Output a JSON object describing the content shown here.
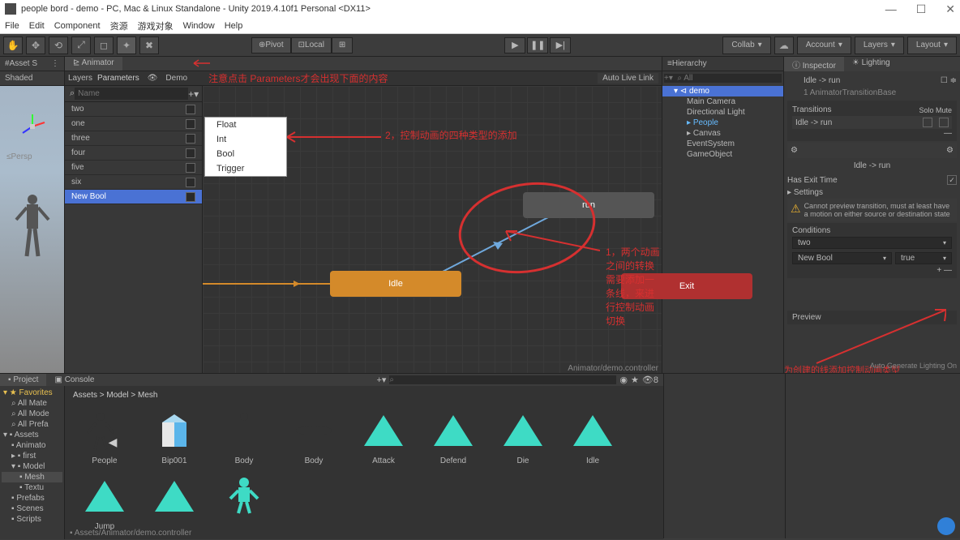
{
  "titlebar": {
    "text": "people bord - demo - PC, Mac & Linux Standalone - Unity 2019.4.10f1 Personal <DX11>"
  },
  "menu": [
    "File",
    "Edit",
    "Component",
    "资源",
    "游戏对象",
    "Window",
    "Help"
  ],
  "toolbar": {
    "pivot": "Pivot",
    "local": "Local",
    "collab": "Collab",
    "account": "Account",
    "layers": "Layers",
    "layout": "Layout"
  },
  "scene": {
    "tab": "Asset S",
    "shaded": "Shaded",
    "persp": "≤Persp"
  },
  "animator": {
    "tab": "Animator",
    "layers": "Layers",
    "parameters": "Parameters",
    "demo": "Demo",
    "live": "Auto Live Link",
    "search_ph": "Name",
    "params": [
      "two",
      "one",
      "three",
      "four",
      "five",
      "six",
      "New Bool"
    ],
    "types": [
      "Float",
      "Int",
      "Bool",
      "Trigger"
    ],
    "nodes": {
      "run": "run",
      "idle": "Idle",
      "exit": "Exit"
    },
    "footer": "Animator/demo.controller",
    "ann1": "注意点击 Parameters才会出现下面的内容",
    "ann2": "2，控制动画的四种类型的添加",
    "ann3": "1，两个动画之间的转换需要添加一条线，来进行控制动画切换"
  },
  "project": {
    "tab_project": "Project",
    "tab_console": "Console",
    "favorites": "Favorites",
    "fav_items": [
      "All Mate",
      "All Mode",
      "All Prefa"
    ],
    "assets_root": "Assets",
    "folders": [
      "Animato",
      "first",
      "Model",
      "Mesh",
      "Textu",
      "Prefabs",
      "Scenes",
      "Scripts"
    ],
    "breadcrumb": "Assets > Model > Mesh",
    "items": [
      "People",
      "Bip001",
      "Body",
      "Body",
      "Attack",
      "Defend",
      "Die",
      "Idle",
      "Jump"
    ],
    "path": "Assets/Animator/demo.controller"
  },
  "hierarchy": {
    "title": "Hierarchy",
    "scene": "demo",
    "items": [
      "Main Camera",
      "Directional Light",
      "People",
      "Canvas",
      "EventSystem",
      "GameObject"
    ]
  },
  "inspector": {
    "tab_inspector": "Inspector",
    "tab_lighting": "Lighting",
    "title": "Idle -> run",
    "base": "1 AnimatorTransitionBase",
    "transitions": "Transitions",
    "solo": "Solo",
    "mute": "Mute",
    "trans_item": "Idle -> run",
    "trans_item2": "Idle -> run",
    "has_exit": "Has Exit Time",
    "settings": "Settings",
    "warning": "Cannot preview transition, must at least have a motion on either source or destination state",
    "conditions": "Conditions",
    "cond1": "two",
    "cond2": "New Bool",
    "cond2_val": "true",
    "preview": "Preview",
    "ann": "为创建的线添加控制动画类型",
    "footer": "Auto Generate Lighting On"
  }
}
